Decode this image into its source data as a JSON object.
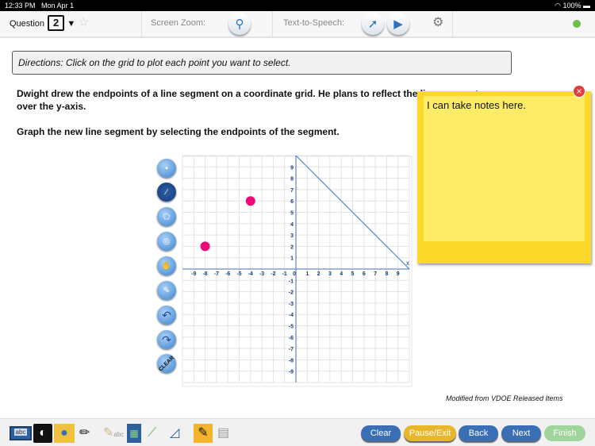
{
  "status_bar": {
    "time": "12:33 PM",
    "date": "Mon Apr 1",
    "battery": "100%"
  },
  "toolbar": {
    "question_label": "Question",
    "question_number": "2",
    "screen_zoom_label": "Screen Zoom:",
    "tts_label": "Text-to-Speech:"
  },
  "directions": "Directions: Click on the grid to plot each point you want to select.",
  "question": {
    "line1": "Dwight drew the endpoints of a line segment on a coordinate grid. He plans to reflect the line segment",
    "line2": "over the y-axis.",
    "line3": "Graph the new line segment by selecting the endpoints of the segment."
  },
  "graph_tools": [
    "point",
    "segment",
    "polygon",
    "circle",
    "hand",
    "eraser",
    "undo",
    "redo",
    "CLEAR"
  ],
  "grid": {
    "xlim": [
      -10,
      10
    ],
    "ylim": [
      -10,
      10
    ],
    "x_axis_label": "x",
    "x_ticks": [
      -9,
      -8,
      -7,
      -6,
      -5,
      -4,
      -3,
      -2,
      -1,
      0,
      1,
      2,
      3,
      4,
      5,
      6,
      7,
      8,
      9
    ],
    "y_ticks": [
      9,
      8,
      7,
      6,
      5,
      4,
      3,
      2,
      1,
      -1,
      -2,
      -3,
      -4,
      -5,
      -6,
      -7,
      -8,
      -9
    ],
    "points": [
      [
        -8,
        2
      ],
      [
        -4,
        6
      ]
    ],
    "line": [
      [
        0,
        10
      ],
      [
        10,
        0
      ]
    ],
    "point_color": "#ef0a78",
    "line_color": "#5b8fd6"
  },
  "notes": {
    "text": "I can take notes here."
  },
  "credit": "Modified from VDOE Released Items",
  "bottom": {
    "buttons": [
      "Clear",
      "Pause/Exit",
      "Back",
      "Next",
      "Finish"
    ],
    "abc_label": "abc",
    "highlighter_label": "abc"
  }
}
